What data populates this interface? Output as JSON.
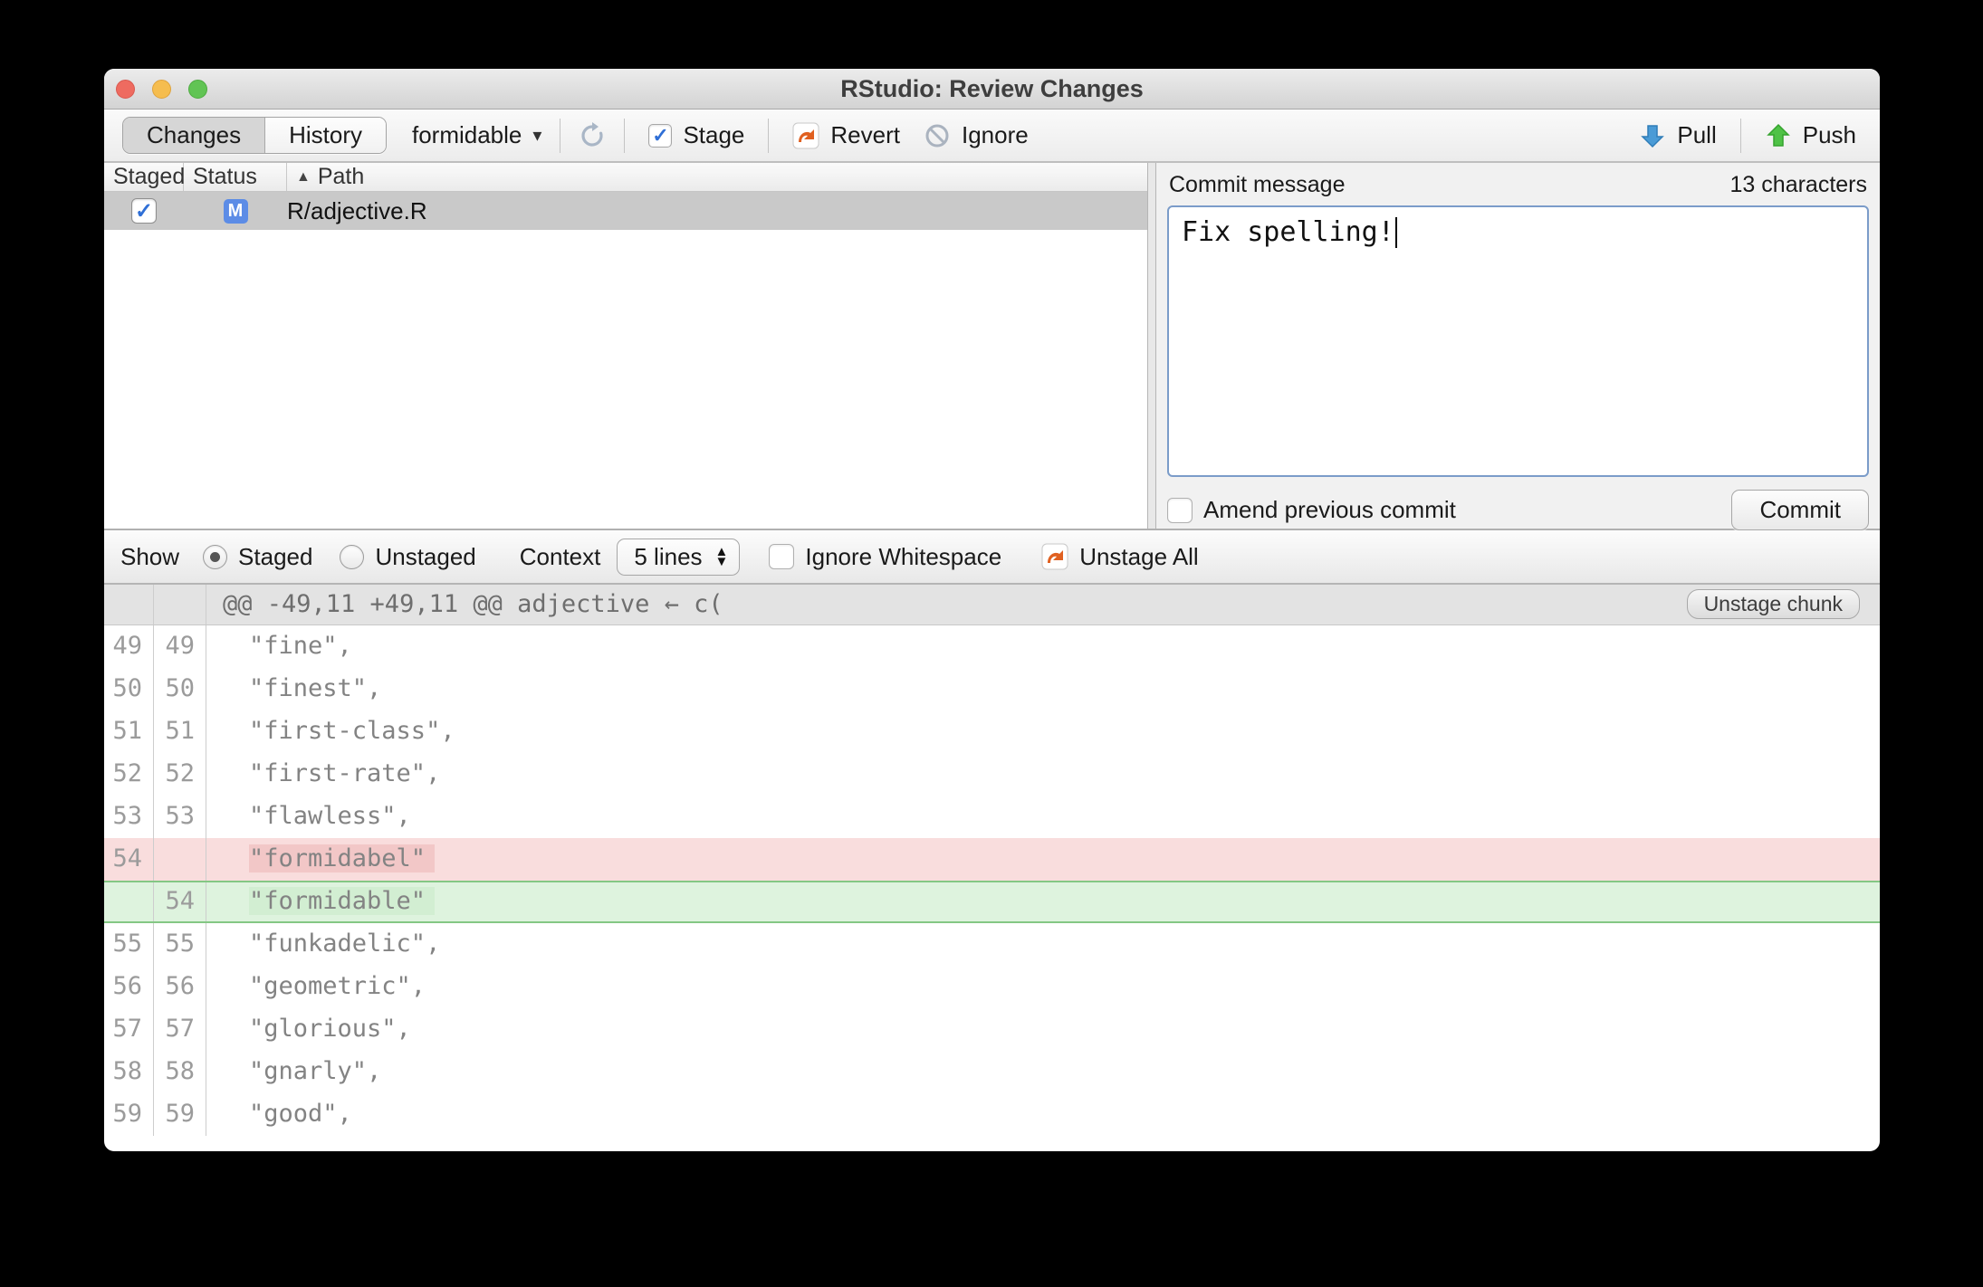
{
  "window": {
    "title": "RStudio: Review Changes"
  },
  "toolbar": {
    "tabs": [
      {
        "label": "Changes",
        "selected": true
      },
      {
        "label": "History",
        "selected": false
      }
    ],
    "branch": "formidable",
    "stage_label": "Stage",
    "revert_label": "Revert",
    "ignore_label": "Ignore",
    "pull_label": "Pull",
    "push_label": "Push"
  },
  "icons": {
    "sort_asc": "▲",
    "dropdown_caret": "▾",
    "check": "✓",
    "stepper_up": "▲",
    "stepper_down": "▼"
  },
  "file_list": {
    "columns": {
      "staged": "Staged",
      "status": "Status",
      "path": "Path"
    },
    "rows": [
      {
        "staged": true,
        "status": "M",
        "path": "R/adjective.R"
      }
    ]
  },
  "commit": {
    "label": "Commit message",
    "char_count": "13 characters",
    "message": "Fix spelling!",
    "amend_label": "Amend previous commit",
    "commit_label": "Commit"
  },
  "diff_toolbar": {
    "show_label": "Show",
    "staged_label": "Staged",
    "unstaged_label": "Unstaged",
    "context_label": "Context",
    "context_value": "5 lines",
    "ignore_whitespace_label": "Ignore Whitespace",
    "unstage_all_label": "Unstage All"
  },
  "diff": {
    "hunk_header": "@@ -49,11 +49,11 @@ adjective ← c(",
    "unstage_chunk_label": "Unstage chunk",
    "lines": [
      {
        "old": "49",
        "new": "49",
        "code": "\"fine\",",
        "type": "context"
      },
      {
        "old": "50",
        "new": "50",
        "code": "\"finest\",",
        "type": "context"
      },
      {
        "old": "51",
        "new": "51",
        "code": "\"first-class\",",
        "type": "context"
      },
      {
        "old": "52",
        "new": "52",
        "code": "\"first-rate\",",
        "type": "context"
      },
      {
        "old": "53",
        "new": "53",
        "code": "\"flawless\",",
        "type": "context"
      },
      {
        "old": "54",
        "new": "",
        "code": "\"formidabel\"",
        "type": "removed"
      },
      {
        "old": "",
        "new": "54",
        "code": "\"formidable\"",
        "type": "added"
      },
      {
        "old": "55",
        "new": "55",
        "code": "\"funkadelic\",",
        "type": "context"
      },
      {
        "old": "56",
        "new": "56",
        "code": "\"geometric\",",
        "type": "context"
      },
      {
        "old": "57",
        "new": "57",
        "code": "\"glorious\",",
        "type": "context"
      },
      {
        "old": "58",
        "new": "58",
        "code": "\"gnarly\",",
        "type": "context"
      },
      {
        "old": "59",
        "new": "59",
        "code": "\"good\",",
        "type": "context"
      }
    ]
  },
  "colors": {
    "removed_bg": "#f9dddd",
    "removed_hl": "#f2c7c7",
    "added_bg": "#def3de",
    "added_hl": "#d2eed2",
    "added_border": "#84c784",
    "status_badge": "#5c8ce6",
    "focus_border": "#7b9cc9",
    "traffic_red": "#ee6b60",
    "traffic_yellow": "#f5bd4f",
    "traffic_green": "#61c454",
    "pull_arrow": "#4a9bd6",
    "push_arrow": "#4fc246",
    "revert_arrow": "#e06020"
  }
}
